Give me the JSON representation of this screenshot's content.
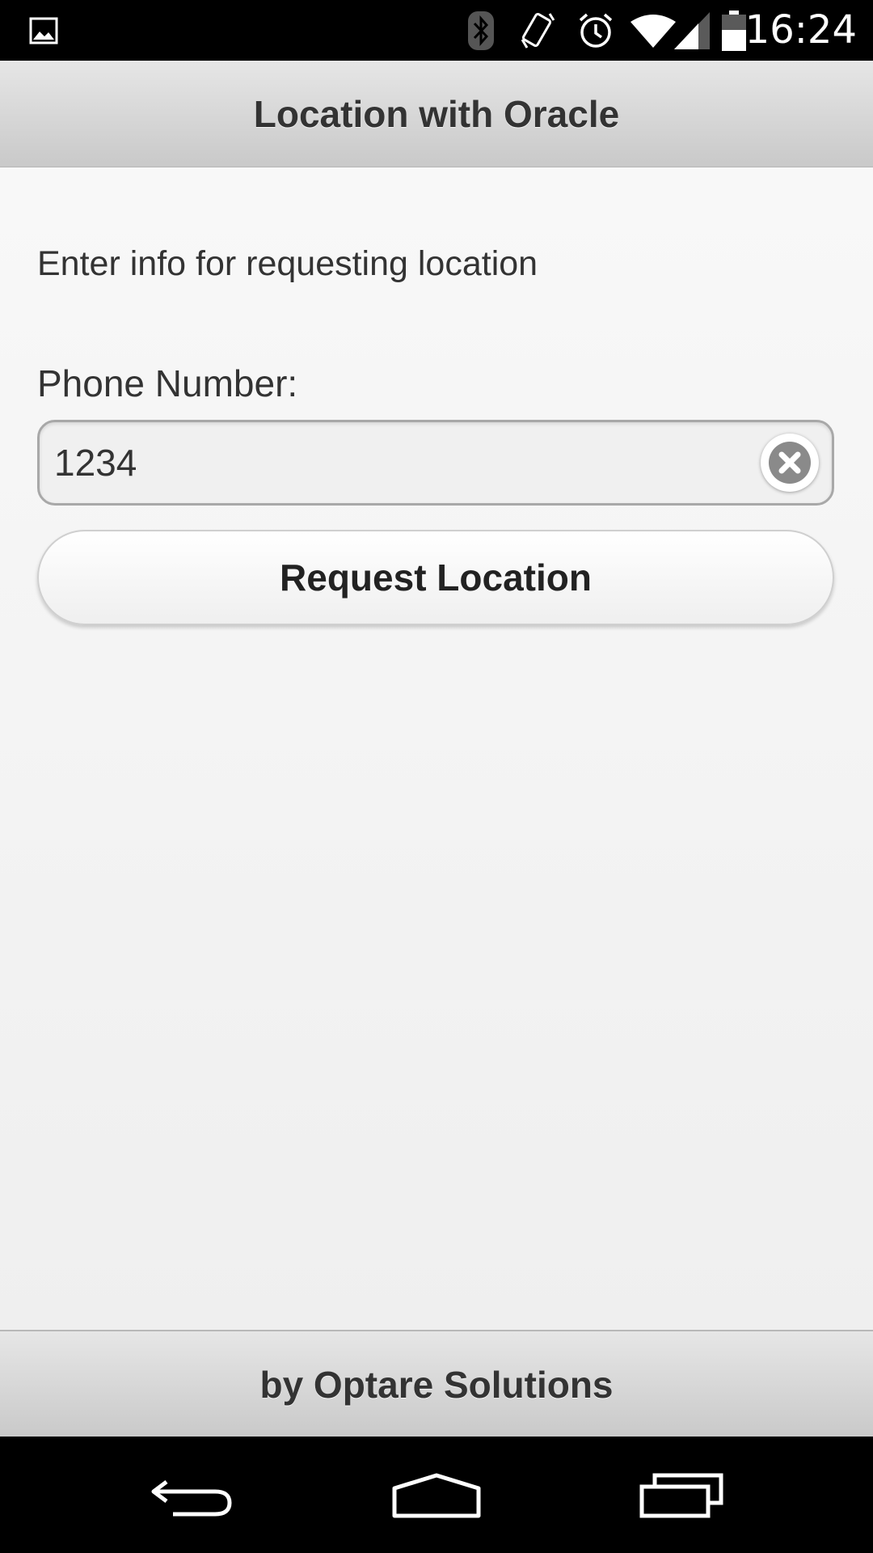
{
  "status_bar": {
    "time": "16:24",
    "icons": [
      "image-notification-icon",
      "bluetooth-icon",
      "vibrate-icon",
      "alarm-icon",
      "wifi-icon",
      "signal-icon",
      "battery-icon"
    ]
  },
  "header": {
    "title": "Location with Oracle"
  },
  "main": {
    "intro_text": "Enter info for requesting location",
    "phone_label": "Phone Number:",
    "phone_value": "1234",
    "request_button_label": "Request Location"
  },
  "footer": {
    "credit": "by Optare Solutions"
  },
  "navigation": {
    "buttons": [
      "back-icon",
      "home-icon",
      "recents-icon"
    ]
  },
  "colors": {
    "bar_background": "#000000",
    "header_gradient_top": "#e6e6e6",
    "header_gradient_bottom": "#c9c9c9",
    "text": "#333333"
  }
}
